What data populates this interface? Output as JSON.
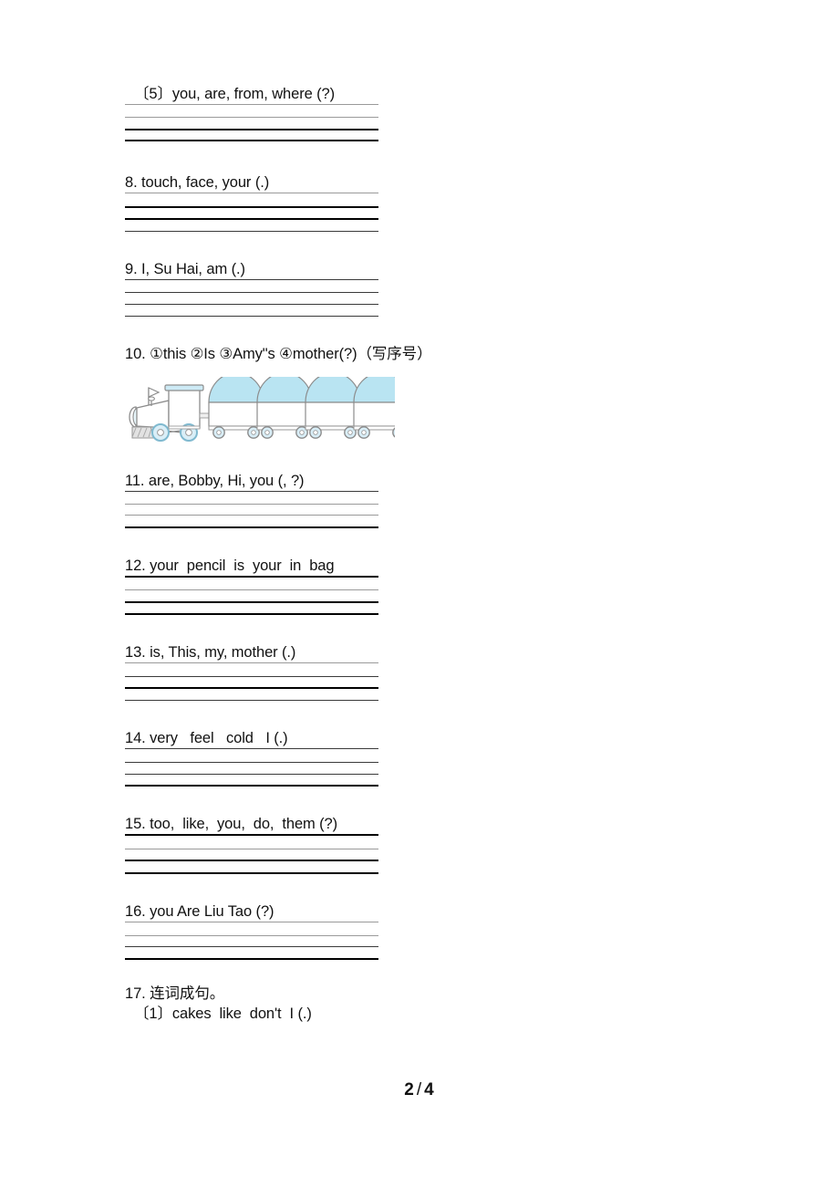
{
  "document": {
    "type": "worksheet",
    "language_note": "English word-ordering exercise with Chinese instructions",
    "footer": {
      "current_page": "2",
      "separator": "/",
      "total_pages": "4",
      "display": "2 / 4"
    }
  },
  "questions": [
    {
      "id": "q5",
      "number": "〔5〕",
      "text": "〔5〕you, are, from, where (?)",
      "indented": true,
      "lines": [
        "thin",
        "thin",
        "thick",
        "thick"
      ]
    },
    {
      "id": "q8",
      "number": "8.",
      "text": "8. touch, face, your (.)",
      "indented": false,
      "lines": [
        "thin",
        "thick",
        "thick",
        "medium"
      ]
    },
    {
      "id": "q9",
      "number": "9.",
      "text": "9. I, Su Hai, am (.)",
      "indented": false,
      "lines": [
        "medium",
        "medium",
        "medium",
        "medium"
      ]
    },
    {
      "id": "q10",
      "number": "10.",
      "text": "10. ①this ②Is ③Amy\"s ④mother(?)（写序号）",
      "indented": false,
      "lines": [],
      "illustration": "train-clipart"
    },
    {
      "id": "q11",
      "number": "11.",
      "text": "11. are, Bobby, Hi, you (, ?)",
      "indented": false,
      "lines": [
        "medium",
        "thin",
        "thin",
        "thick"
      ]
    },
    {
      "id": "q12",
      "number": "12.",
      "text": "12. your  pencil  is  your  in  bag",
      "indented": false,
      "lines": [
        "thick",
        "thin",
        "thick",
        "thick"
      ]
    },
    {
      "id": "q13",
      "number": "13.",
      "text": "13. is, This, my, mother (.)",
      "indented": false,
      "lines": [
        "thin",
        "medium",
        "thick",
        "medium"
      ]
    },
    {
      "id": "q14",
      "number": "14.",
      "text": "14. very   feel   cold   I (.)",
      "indented": false,
      "lines": [
        "medium",
        "medium",
        "medium",
        "thick"
      ]
    },
    {
      "id": "q15",
      "number": "15.",
      "text": "15. too,  like,  you,  do,  them (?)",
      "indented": false,
      "lines": [
        "thick",
        "thin",
        "thick",
        "thick"
      ]
    },
    {
      "id": "q16",
      "number": "16.",
      "text": "16. you Are Liu Tao (?)",
      "indented": false,
      "lines": [
        "thin",
        "thin",
        "medium",
        "thick"
      ]
    },
    {
      "id": "q17",
      "number": "17.",
      "text": "17. 连词成句。",
      "indented": false,
      "lines": [],
      "subitem": "〔1〕cakes  like  don't  I (.)"
    }
  ],
  "illustration": {
    "name": "train-clipart",
    "description": "Line-art steam locomotive pulling four open carriages with domed loads",
    "colors": {
      "dome_fill": "#b9e4f2",
      "outline": "#8c8c8c",
      "body_fill": "#ffffff",
      "wheel_fill": "#d9eef7",
      "shadow": "#a0a0a0"
    },
    "carriage_count": "4"
  }
}
